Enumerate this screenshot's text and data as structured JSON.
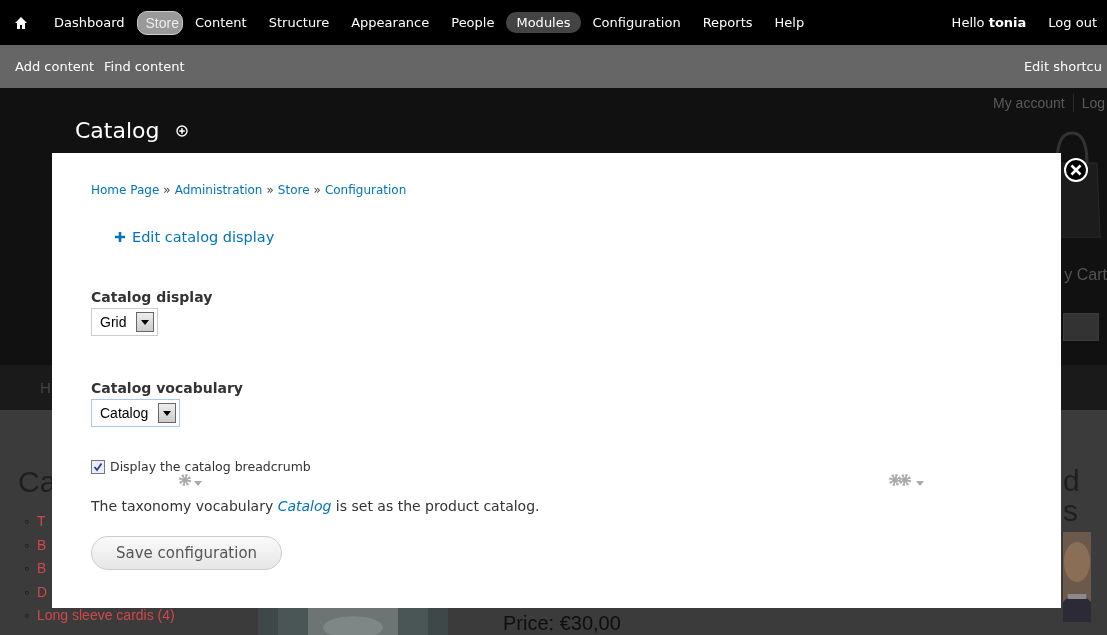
{
  "toolbar": {
    "items": [
      {
        "label": "Dashboard",
        "selected": false,
        "hovered": false
      },
      {
        "label": "Store",
        "selected": true,
        "hovered": false
      },
      {
        "label": "Content",
        "selected": false,
        "hovered": false
      },
      {
        "label": "Structure",
        "selected": false,
        "hovered": false
      },
      {
        "label": "Appearance",
        "selected": false,
        "hovered": false
      },
      {
        "label": "People",
        "selected": false,
        "hovered": false
      },
      {
        "label": "Modules",
        "selected": false,
        "hovered": true
      },
      {
        "label": "Configuration",
        "selected": false,
        "hovered": false
      },
      {
        "label": "Reports",
        "selected": false,
        "hovered": false
      },
      {
        "label": "Help",
        "selected": false,
        "hovered": false
      }
    ],
    "greeting": "Hello **tonia**",
    "logout": "Log out"
  },
  "shortcuts": {
    "items": [
      "Add content",
      "Find content"
    ],
    "edit": "Edit shortcu"
  },
  "background_page": {
    "account_links": [
      "My account",
      "Log"
    ],
    "overlay_title": "Catalog",
    "cart": "y Cart",
    "nav": "H",
    "heading_left": "Ca",
    "list_marker": "◦",
    "categories": [
      "T",
      "B",
      "B",
      "D",
      "Long sleeve cardis (4)"
    ],
    "price": "Price: €30,00",
    "heading_right": [
      "d",
      "s"
    ]
  },
  "modal": {
    "breadcrumb": [
      "Home Page",
      "Administration",
      "Store",
      "Configuration"
    ],
    "breadcrumb_separator": "»",
    "edit_link": "Edit catalog display",
    "fields": [
      {
        "kind": "select",
        "label": "Catalog display",
        "value": "Grid",
        "focused": false
      },
      {
        "kind": "select",
        "label": "Catalog vocabulary",
        "value": "Catalog",
        "focused": true
      },
      {
        "kind": "checkbox",
        "label": "Display the catalog breadcrumb",
        "checked": true
      }
    ],
    "description": {
      "before": "The taxonomy vocabulary",
      "link": "Catalog",
      "after": "is set as the product catalog."
    },
    "button": "Save configuration"
  }
}
